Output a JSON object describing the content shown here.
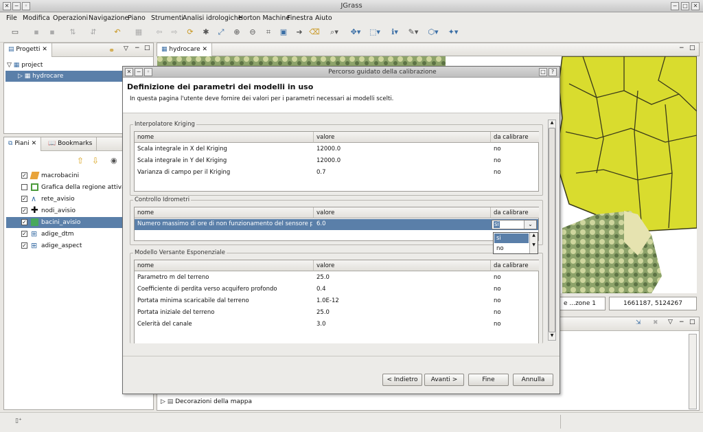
{
  "app": {
    "title": "JGrass"
  },
  "menu": [
    "File",
    "Modifica",
    "Operazioni",
    "Navigazione",
    "Piano",
    "Strumenti",
    "Analisi idrologiche",
    "Horton Machine",
    "Finestra",
    "Aiuto"
  ],
  "projects": {
    "tab": "Progetti",
    "root": "project",
    "child": "hydrocare"
  },
  "layers_panel": {
    "tab_layers": "Piani",
    "tab_bookmarks": "Bookmarks",
    "layers": [
      {
        "name": "macrobacini",
        "checked": true,
        "icon": "polygon-orange-icon"
      },
      {
        "name": "Grafica della regione attiva",
        "checked": false,
        "icon": "region-green-icon"
      },
      {
        "name": "rete_avisio",
        "checked": true,
        "icon": "line-blue-icon"
      },
      {
        "name": "nodi_avisio",
        "checked": true,
        "icon": "point-black-icon"
      },
      {
        "name": "bacini_avisio",
        "checked": true,
        "icon": "polygon-green-icon",
        "selected": true
      },
      {
        "name": "adige_dtm",
        "checked": true,
        "icon": "raster-grid-icon"
      },
      {
        "name": "adige_aspect",
        "checked": true,
        "icon": "raster-grid-icon"
      }
    ]
  },
  "map": {
    "tab": "hydrocare",
    "scale_text": "e ...zone 1",
    "coords": "1661187, 5124267"
  },
  "lower_panel": {
    "item": "Decorazioni della mappa"
  },
  "dialog": {
    "title": "Percorso guidato della calibrazione",
    "heading": "Definizione dei parametri dei modelli in uso",
    "description": "In questa pagina l'utente deve fornire dei valori per i parametri necessari ai modelli scelti.",
    "columns": [
      "nome",
      "valore",
      "da calibrare"
    ],
    "groups": [
      {
        "label": "Interpolatore Kriging",
        "rows": [
          [
            "Scala integrale in X del Kriging",
            "12000.0",
            "no"
          ],
          [
            "Scala integrale in Y del Kriging",
            "12000.0",
            "no"
          ],
          [
            "Varianza di campo per il Kriging",
            "0.7",
            "no"
          ]
        ]
      },
      {
        "label": "Controllo Idrometri",
        "rows": [
          [
            "Numero massimo di ore di non funzionamento del sensore per disa",
            "6.0",
            "si"
          ]
        ],
        "dropdown_options": [
          "si",
          "no"
        ]
      },
      {
        "label": "Modello Versante Esponenziale",
        "rows": [
          [
            "Parametro m del terreno",
            "25.0",
            "no"
          ],
          [
            "Coefficiente di perdita verso acquifero profondo",
            "0.4",
            "no"
          ],
          [
            "Portata minima scaricabile dal terreno",
            "1.0E-12",
            "no"
          ],
          [
            "Portata iniziale del terreno",
            "25.0",
            "no"
          ],
          [
            "Celerità del canale",
            "3.0",
            "no"
          ]
        ]
      }
    ],
    "buttons": {
      "back": "< Indietro",
      "next": "Avanti >",
      "finish": "Fine",
      "cancel": "Annulla"
    }
  },
  "colors": {
    "selection": "#5a7fa9",
    "map_yellow": "#d9dc2e"
  }
}
